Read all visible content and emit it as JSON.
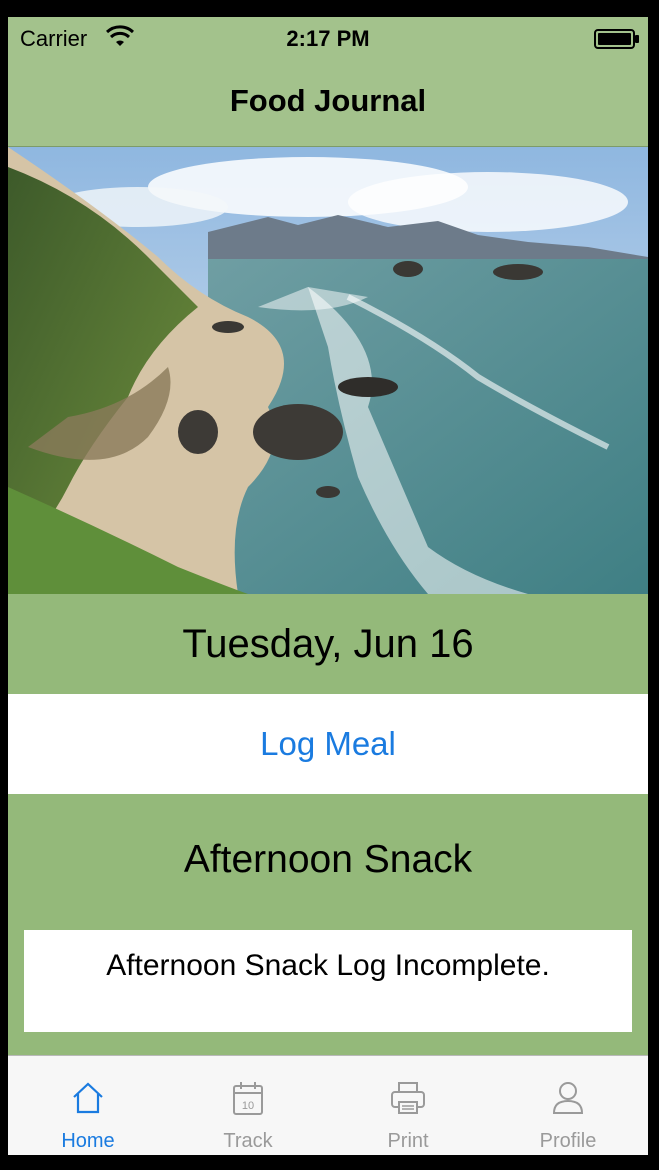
{
  "status_bar": {
    "carrier": "Carrier",
    "time": "2:17 PM"
  },
  "nav": {
    "title": "Food Journal"
  },
  "hero": {
    "icon": "coastal-landscape-photo"
  },
  "date_label": "Tuesday, Jun 16",
  "log_meal_label": "Log Meal",
  "meal": {
    "title": "Afternoon Snack",
    "status": "Afternoon Snack Log Incomplete."
  },
  "tabs": [
    {
      "label": "Home",
      "icon": "home-icon",
      "active": true
    },
    {
      "label": "Track",
      "icon": "calendar-icon",
      "active": false
    },
    {
      "label": "Print",
      "icon": "printer-icon",
      "active": false
    },
    {
      "label": "Profile",
      "icon": "person-icon",
      "active": false
    }
  ],
  "colors": {
    "bar_green": "#a3c28c",
    "band_green": "#94b97a",
    "accent_blue": "#1a7be0",
    "inactive_gray": "#9a9a9a"
  }
}
